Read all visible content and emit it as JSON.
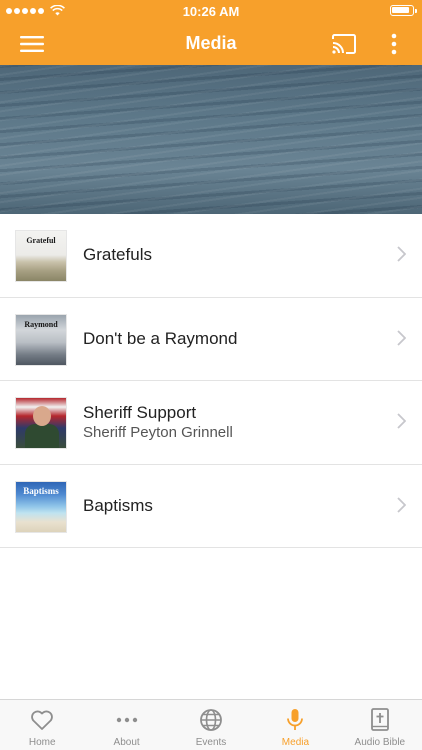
{
  "status_bar": {
    "time": "10:26 AM"
  },
  "nav": {
    "title": "Media"
  },
  "media_items": [
    {
      "title": "Gratefuls",
      "subtitle": "",
      "thumb_text": "Grateful",
      "icon": "grateful-thumbnail"
    },
    {
      "title": "Don't be a Raymond",
      "subtitle": "",
      "thumb_text": "Raymond",
      "icon": "raymond-thumbnail"
    },
    {
      "title": "Sheriff Support",
      "subtitle": "Sheriff Peyton Grinnell",
      "thumb_text": "",
      "icon": "sheriff-thumbnail"
    },
    {
      "title": "Baptisms",
      "subtitle": "",
      "thumb_text": "Baptisms",
      "icon": "baptisms-thumbnail"
    }
  ],
  "tabs": [
    {
      "label": "Home",
      "icon": "heart-icon",
      "active": false
    },
    {
      "label": "About",
      "icon": "ellipsis-icon",
      "active": false
    },
    {
      "label": "Events",
      "icon": "globe-icon",
      "active": false
    },
    {
      "label": "Media",
      "icon": "microphone-icon",
      "active": true
    },
    {
      "label": "Audio Bible",
      "icon": "bible-icon",
      "active": false
    }
  ],
  "colors": {
    "accent": "#f7a02b",
    "tab_inactive": "#8e8e8e"
  }
}
